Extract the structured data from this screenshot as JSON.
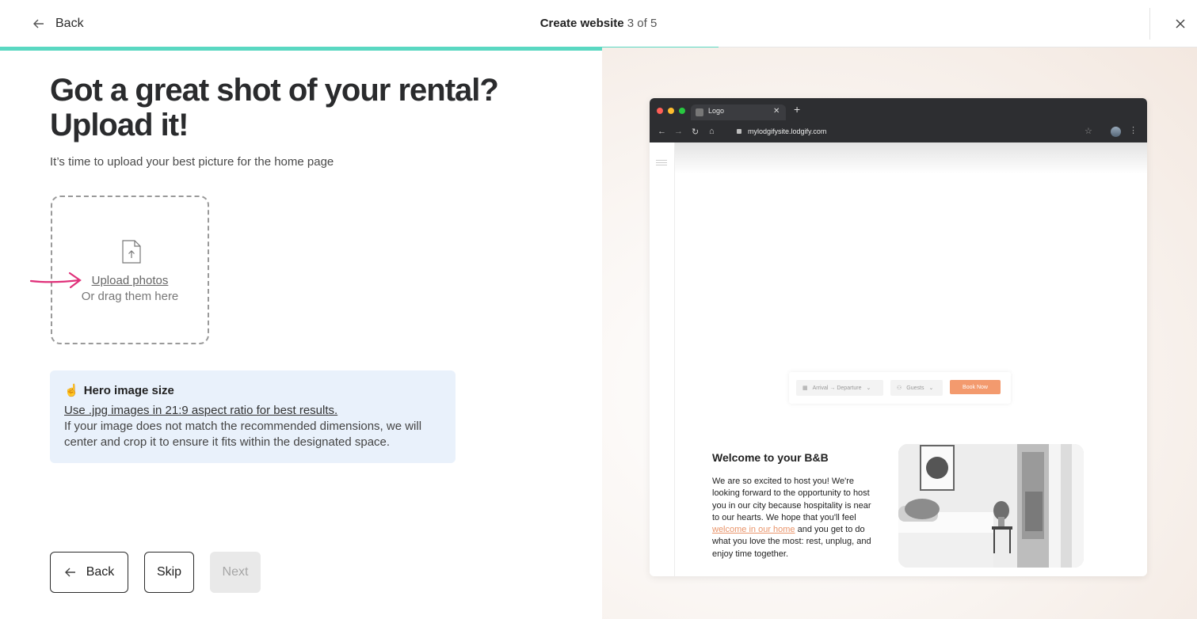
{
  "header": {
    "back_label": "Back",
    "title": "Create website",
    "step": "3 of 5",
    "progress_fraction": 0.6
  },
  "main": {
    "heading": "Got a great shot of your rental? Upload it!",
    "subtitle": "It’s time to upload your best picture for the home page",
    "upload": {
      "link_label": "Upload photos",
      "drag_label": "Or drag them here"
    },
    "info": {
      "emoji": "☝️",
      "title": "Hero image size",
      "link": "Use .jpg images in 21:9 aspect ratio for best results.",
      "text": "If your image does not match the recommended dimensions, we will center and crop it to ensure it fits within the designated space."
    }
  },
  "footer": {
    "back_label": "Back",
    "skip_label": "Skip",
    "next_label": "Next"
  },
  "preview": {
    "tab_label": "Logo",
    "url": "mylodgifysite.lodgify.com",
    "booking": {
      "dates_label": "Arrival → Departure",
      "guests_label": "Guests",
      "book_label": "Book Now"
    },
    "welcome_title": "Welcome to your B&B",
    "welcome_text_before": "We are so excited to host you! We're looking forward to the opportunity to host you in our city because hospitality is near to our hearts. We hope that you'll feel ",
    "welcome_link": "welcome in our home",
    "welcome_text_after": " and you get to do what you love the most: rest, unplug, and enjoy time together."
  },
  "colors": {
    "accent": "#5ad8c2",
    "annotation_arrow": "#e0317a",
    "book_button": "#f39a6e",
    "info_bg": "#e9f1fb"
  }
}
